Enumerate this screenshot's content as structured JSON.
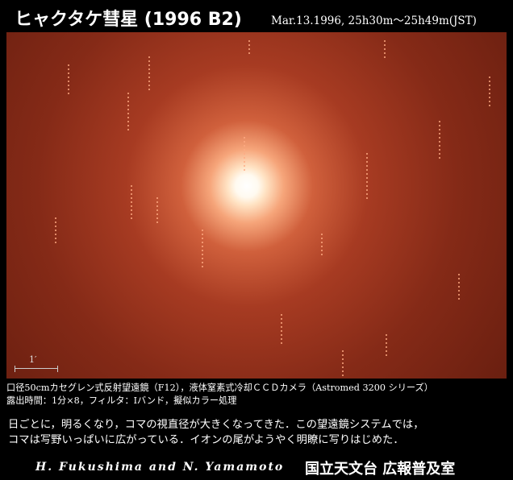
{
  "header": {
    "title": "ヒャクタケ彗星 (1996 B2)",
    "observation_time": "Mar.13.1996, 25h30m〜25h49m(JST)"
  },
  "photo": {
    "scale_label": "1′",
    "background_color": "#7a2414",
    "nucleus_color": "#ffffff"
  },
  "caption": {
    "line1": "口径50cmカセグレン式反射望遠鏡（F12），液体窒素式冷却ＣＣＤカメラ（Astromed 3200 シリーズ）",
    "line2": "露出時間：1分×8，フィルタ：Iバンド，擬似カラー処理"
  },
  "description": {
    "line1": "日ごとに，明るくなり，コマの視直径が大きくなってきた．この望遠鏡システムでは，",
    "line2": "コマは写野いっぱいに広がっている．イオンの尾がようやく明瞭に写りはじめた．"
  },
  "credits": {
    "authors": "H. Fukushima and N. Yamamoto",
    "organization": "国立天文台 広報普及室"
  }
}
